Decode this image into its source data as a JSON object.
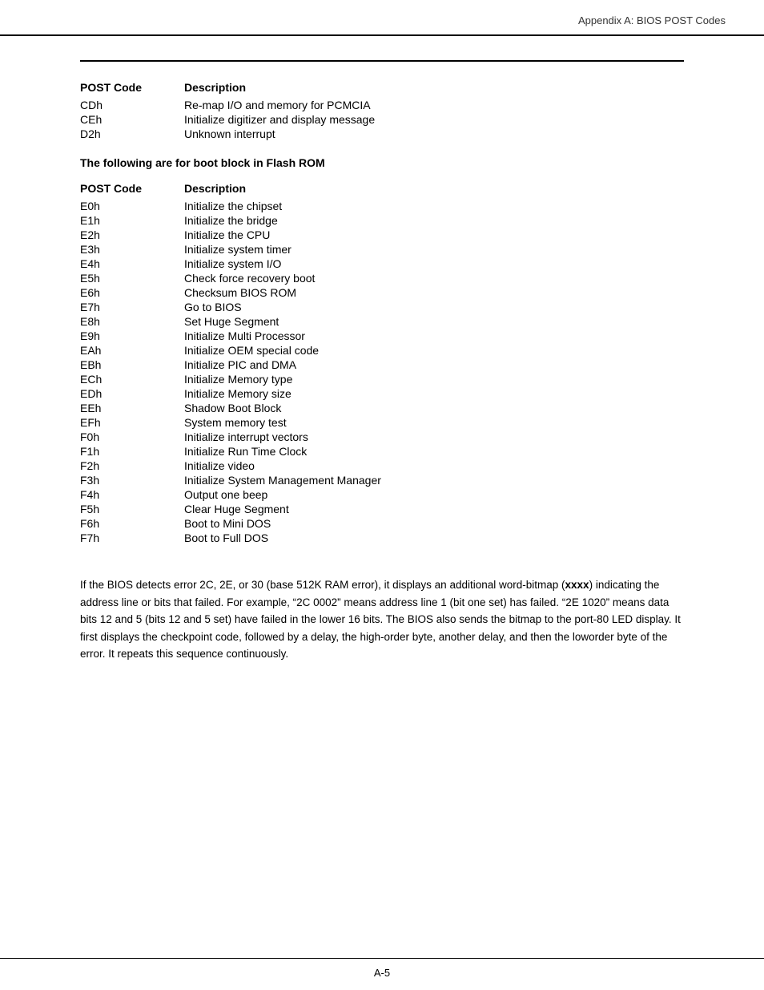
{
  "header": {
    "title": "Appendix A: BIOS POST Codes"
  },
  "top_table": {
    "col1_header": "POST Code",
    "col2_header": "Description",
    "rows": [
      {
        "code": "CDh",
        "desc": "Re-map I/O and memory for PCMCIA"
      },
      {
        "code": "CEh",
        "desc": "Initialize digitizer and display message"
      },
      {
        "code": "D2h",
        "desc": "Unknown interrupt"
      }
    ]
  },
  "flash_rom_heading": "The following are for boot block in Flash ROM",
  "flash_table": {
    "col1_header": "POST Code",
    "col2_header": "Description",
    "rows": [
      {
        "code": "E0h",
        "desc": "Initialize the chipset"
      },
      {
        "code": "E1h",
        "desc": "Initialize the bridge"
      },
      {
        "code": "E2h",
        "desc": "Initialize the CPU"
      },
      {
        "code": "E3h",
        "desc": "Initialize system timer"
      },
      {
        "code": "E4h",
        "desc": "Initialize system I/O"
      },
      {
        "code": "E5h",
        "desc": "Check force recovery boot"
      },
      {
        "code": "E6h",
        "desc": "Checksum BIOS ROM"
      },
      {
        "code": "E7h",
        "desc": "Go to BIOS"
      },
      {
        "code": "E8h",
        "desc": "Set Huge Segment"
      },
      {
        "code": "E9h",
        "desc": "Initialize Multi Processor"
      },
      {
        "code": "EAh",
        "desc": "Initialize OEM special code"
      },
      {
        "code": "EBh",
        "desc": "Initialize PIC and DMA"
      },
      {
        "code": "ECh",
        "desc": "Initialize Memory type"
      },
      {
        "code": "EDh",
        "desc": "Initialize Memory size"
      },
      {
        "code": "EEh",
        "desc": "Shadow Boot Block"
      },
      {
        "code": "EFh",
        "desc": "System memory test"
      },
      {
        "code": "F0h",
        "desc": "Initialize interrupt vectors"
      },
      {
        "code": "F1h",
        "desc": "Initialize Run Time Clock"
      },
      {
        "code": "F2h",
        "desc": "Initialize video"
      },
      {
        "code": "F3h",
        "desc": "Initialize System Management Manager"
      },
      {
        "code": "F4h",
        "desc": "Output one beep"
      },
      {
        "code": "F5h",
        "desc": "Clear Huge Segment"
      },
      {
        "code": "F6h",
        "desc": "Boot to Mini DOS"
      },
      {
        "code": "F7h",
        "desc": "Boot to Full DOS"
      }
    ]
  },
  "paragraph": "If the BIOS detects error 2C, 2E, or 30 (base 512K RAM error), it displays an additional word-bitmap (xxxx) indicating the address line or bits that failed.  For example, “2C 0002” means address line 1 (bit one set) has failed.  “2E 1020” means data bits 12 and 5 (bits 12 and 5 set) have failed in the lower 16 bits.  The BIOS also sends the bitmap to the port-80 LED display.  It first displays the checkpoint code, followed by a delay, the high-order byte, another delay, and then the loworder byte of the error.  It repeats this sequence continuously.",
  "paragraph_bold_word": "xxxx",
  "footer": {
    "page_label": "A-5"
  }
}
